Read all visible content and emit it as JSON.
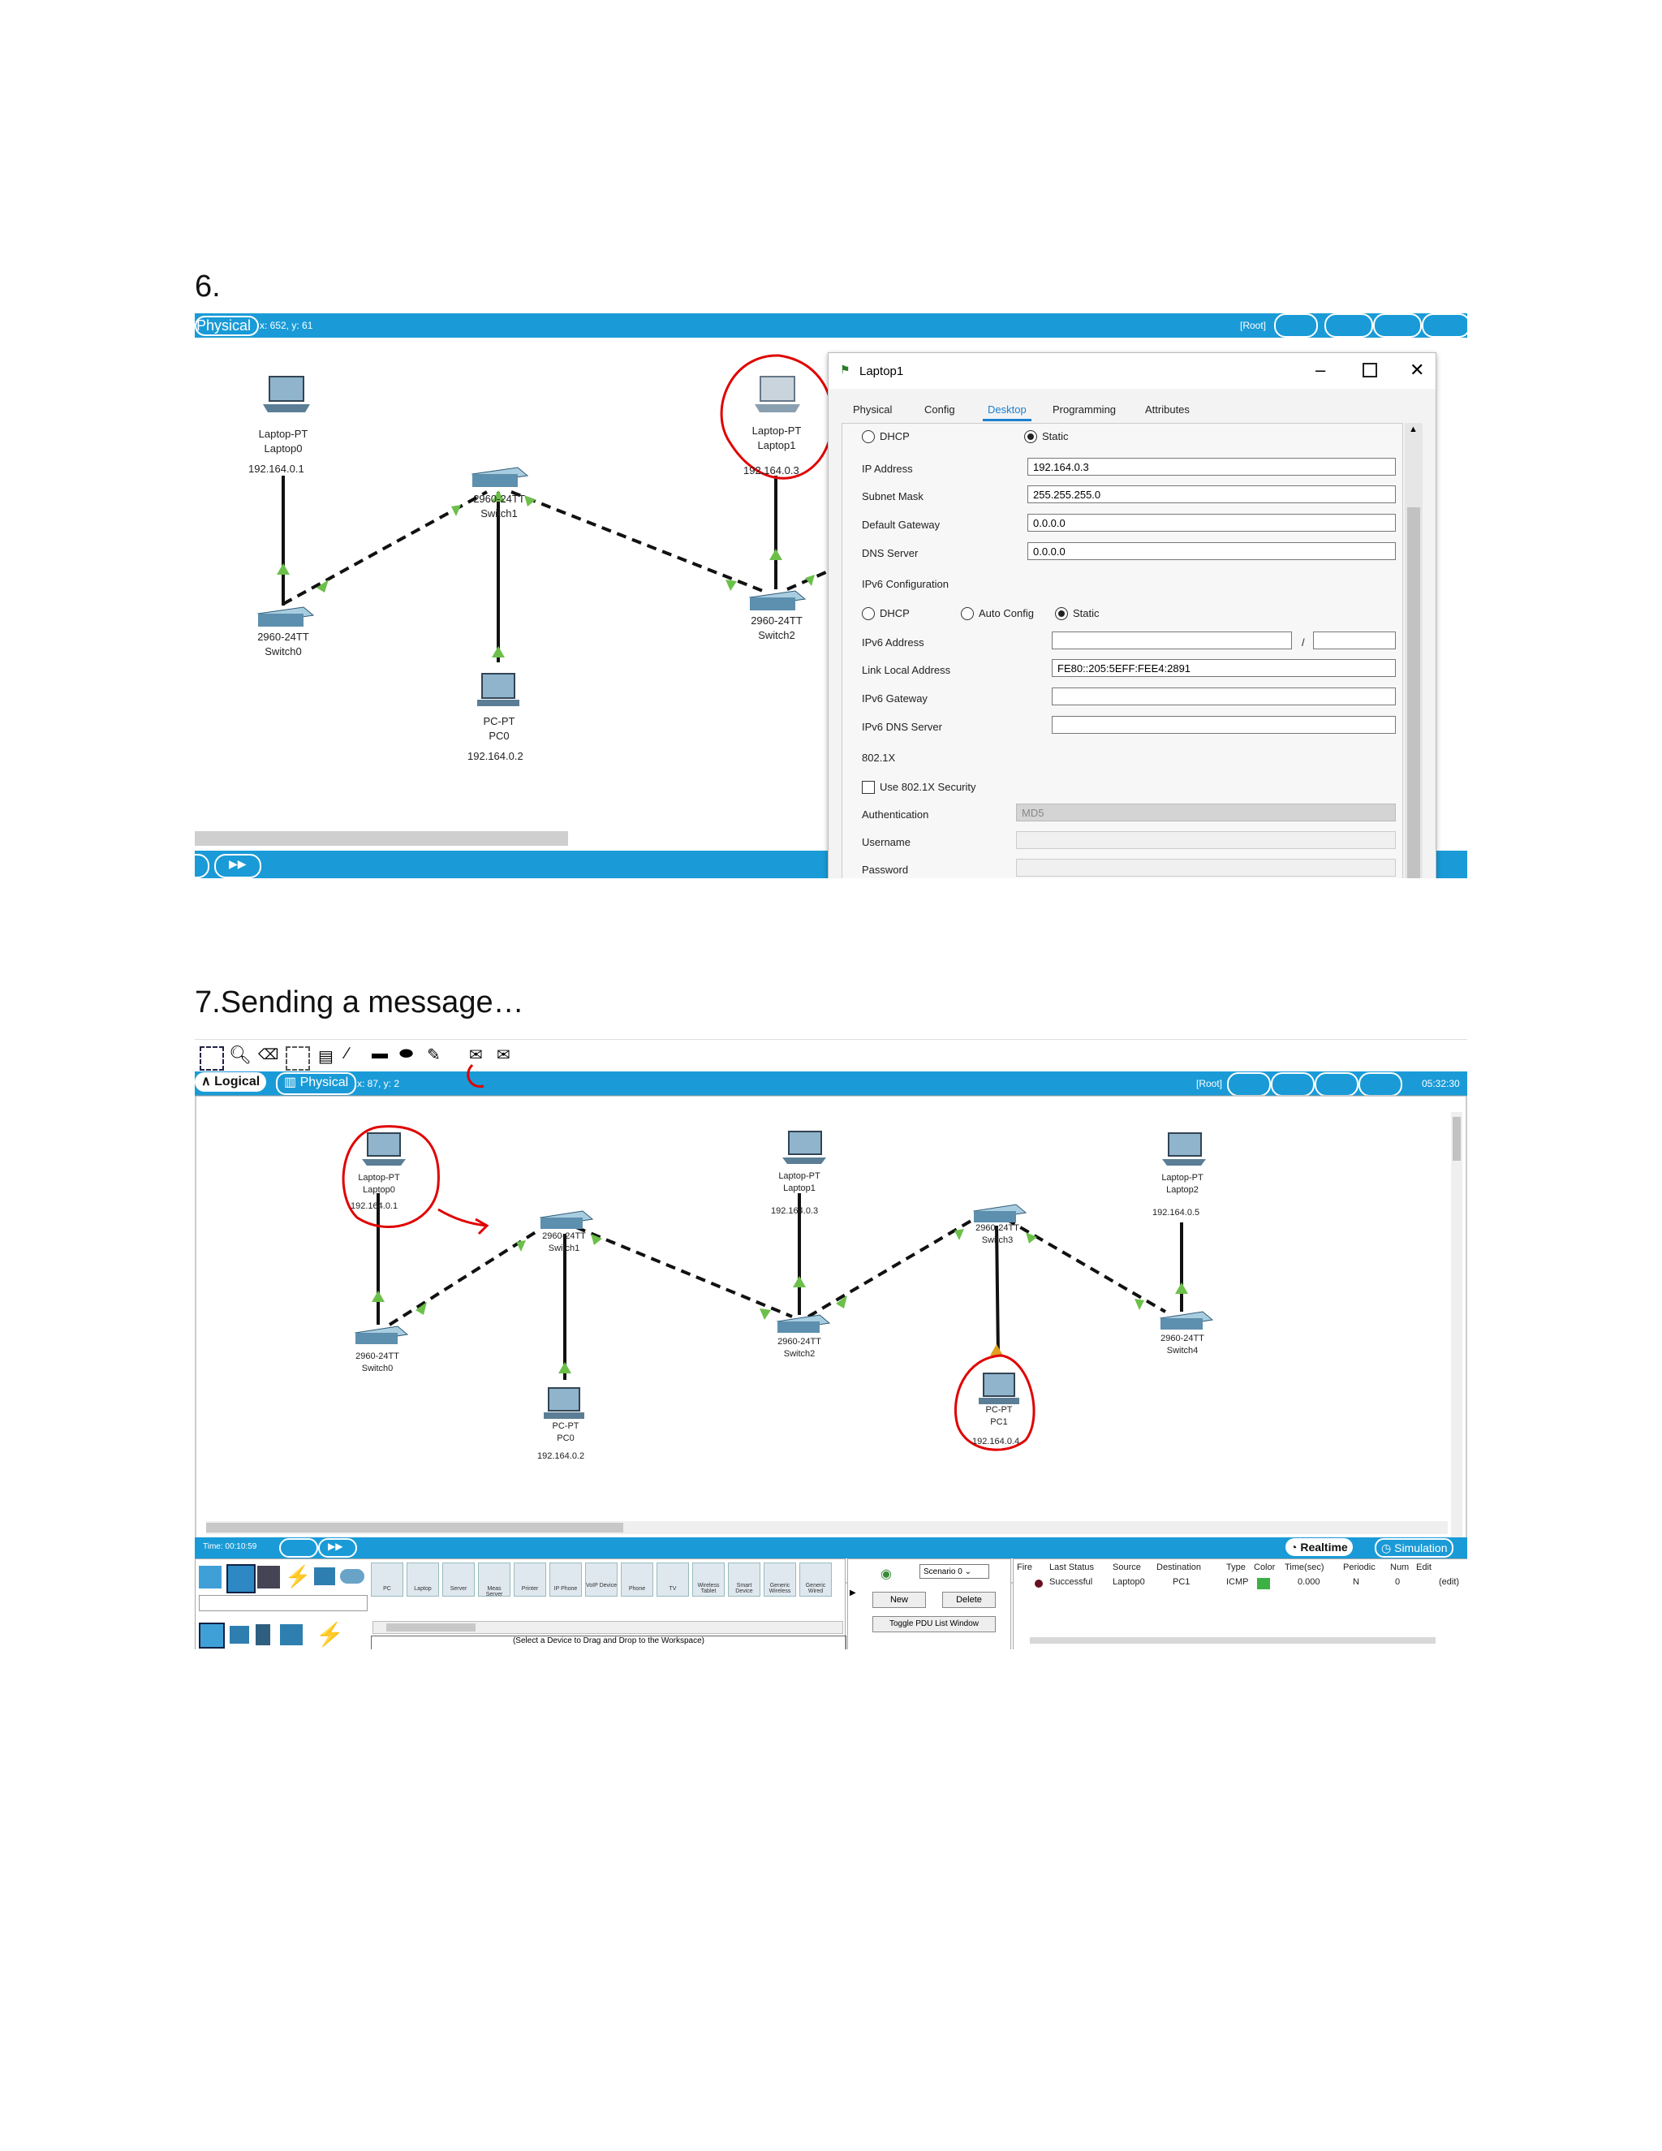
{
  "headings": {
    "step6": "6.",
    "step7": "7.Sending a message…"
  },
  "shot1": {
    "top_bar": {
      "mode_label": "Physical",
      "coords": "x: 652, y: 61",
      "root": "[Root]"
    },
    "devices": [
      {
        "type": "Laptop-PT",
        "name": "Laptop0",
        "ip": "192.164.0.1"
      },
      {
        "type": "2960-24TT",
        "name": "Switch1"
      },
      {
        "type": "Laptop-PT",
        "name": "Laptop1",
        "ip": "192.164.0.3"
      },
      {
        "type": "2960-24TT",
        "name": "Switch0"
      },
      {
        "type": "2960-24TT",
        "name": "Switch2"
      },
      {
        "type": "PC-PT",
        "name": "PC0",
        "ip": "192.164.0.2"
      }
    ],
    "dialog": {
      "title": "Laptop1",
      "tabs": [
        "Physical",
        "Config",
        "Desktop",
        "Programming",
        "Attributes"
      ],
      "active_tab": "Desktop",
      "ipv4": {
        "dhcp_label": "DHCP",
        "static_label": "Static",
        "ip_label": "IP Address",
        "ip_value": "192.164.0.3",
        "mask_label": "Subnet Mask",
        "mask_value": "255.255.255.0",
        "gateway_label": "Default Gateway",
        "gateway_value": "0.0.0.0",
        "dns_label": "DNS Server",
        "dns_value": "0.0.0.0"
      },
      "ipv6": {
        "section": "IPv6 Configuration",
        "dhcp_label": "DHCP",
        "auto_label": "Auto Config",
        "static_label": "Static",
        "addr_label": "IPv6 Address",
        "addr_sep": "/",
        "lla_label": "Link Local Address",
        "lla_value": "FE80::205:5EFF:FEE4:2891",
        "gw_label": "IPv6 Gateway",
        "dns_label": "IPv6 DNS Server"
      },
      "dot1x": {
        "section": "802.1X",
        "use_label": "Use 802.1X Security",
        "auth_label": "Authentication",
        "auth_value": "MD5",
        "user_label": "Username",
        "pass_label": "Password"
      }
    }
  },
  "shot2": {
    "mode_tabs": {
      "logical": "Logical",
      "physical": "Physical",
      "coords": "x: 87, y: 2"
    },
    "root": "[Root]",
    "clock": "05:32:30",
    "devices": [
      {
        "type": "Laptop-PT",
        "name": "Laptop0",
        "ip": "192.164.0.1"
      },
      {
        "type": "2960-24TT",
        "name": "Switch1"
      },
      {
        "type": "Laptop-PT",
        "name": "Laptop1",
        "ip": "192.164.0.3"
      },
      {
        "type": "2960-24TT",
        "name": "Switch3"
      },
      {
        "type": "Laptop-PT",
        "name": "Laptop2",
        "ip": "192.164.0.5"
      },
      {
        "type": "2960-24TT",
        "name": "Switch0"
      },
      {
        "type": "2960-24TT",
        "name": "Switch2"
      },
      {
        "type": "2960-24TT",
        "name": "Switch4"
      },
      {
        "type": "PC-PT",
        "name": "PC0",
        "ip": "192.164.0.2"
      },
      {
        "type": "PC-PT",
        "name": "PC1",
        "ip": "192.164.0.4"
      }
    ],
    "time_label": "Time: 00:10:59",
    "realtime": "Realtime",
    "simulation": "Simulation",
    "device_types": [
      "PC",
      "Laptop",
      "Server",
      "Meas Server",
      "Printer",
      "IP Phone",
      "VoIP Device",
      "Phone",
      "TV",
      "Wireless Tablet",
      "Smart Device",
      "Generic Wireless",
      "Generic Wired"
    ],
    "drag_hint": "(Select a Device to Drag and Drop to the Workspace)",
    "scenario": "Scenario 0",
    "new_btn": "New",
    "delete_btn": "Delete",
    "toggle_btn": "Toggle PDU List Window",
    "pdu_headers": [
      "Fire",
      "Last Status",
      "Source",
      "Destination",
      "Type",
      "Color",
      "Time(sec)",
      "Periodic",
      "Num",
      "Edit"
    ],
    "pdu_row": {
      "status": "Successful",
      "source": "Laptop0",
      "destination": "PC1",
      "type": "ICMP",
      "color": "#3cb043",
      "time": "0.000",
      "periodic": "N",
      "num": "0",
      "edit": "(edit)"
    }
  }
}
